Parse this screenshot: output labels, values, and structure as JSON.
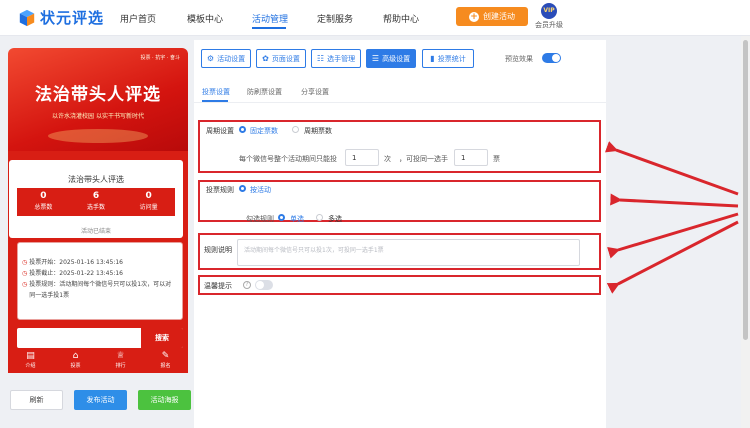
{
  "brand": {
    "name": "状元评选"
  },
  "nav": {
    "items": [
      "用户首页",
      "模板中心",
      "活动管理",
      "定制服务",
      "帮助中心"
    ],
    "active_index": 2,
    "create_label": "创建活动",
    "vip_badge": "VIP",
    "vip_label": "会员升级"
  },
  "preview": {
    "banner_tag": "投票 · 抗宇 · 奋斗",
    "banner_title": "法治带头人评选",
    "banner_sub": "以许水浇灌校园 以实干书写新时代",
    "card_title": "法治带头人评选",
    "stats": [
      {
        "num": "0",
        "label": "总票数"
      },
      {
        "num": "6",
        "label": "选手数"
      },
      {
        "num": "0",
        "label": "访问量"
      }
    ],
    "status": "活动已结束",
    "info": [
      "投票开始：2025-01-16 13:45:16",
      "投票截止：2025-01-22 13:45:16",
      "投票规则：活动期间每个微信号只可以投1次，可以对同一选手投1票"
    ],
    "search_btn": "搜索",
    "tabs": [
      {
        "icon": "list-icon",
        "label": "介绍"
      },
      {
        "icon": "home-icon",
        "label": "投票"
      },
      {
        "icon": "trophy-icon",
        "label": "排行"
      },
      {
        "icon": "signup-icon",
        "label": "报名"
      }
    ]
  },
  "actions": {
    "refresh": "刷新",
    "publish": "发布活动",
    "poster": "活动海报"
  },
  "settings": {
    "toolbar": [
      {
        "icon": "gear-icon",
        "label": "活动设置",
        "active": false
      },
      {
        "icon": "palette-icon",
        "label": "页面设置",
        "active": false
      },
      {
        "icon": "users-icon",
        "label": "选手管理",
        "active": false
      },
      {
        "icon": "sliders-icon",
        "label": "高级设置",
        "active": true
      },
      {
        "icon": "bar-chart-icon",
        "label": "投票统计",
        "active": false
      }
    ],
    "preview_label": "预览效果",
    "subtabs": [
      "投票设置",
      "防刷票设置",
      "分享设置"
    ],
    "cycle": {
      "label": "周期设置",
      "opt1": "固定票数",
      "opt2": "周期票数",
      "sentence_a": "每个微信号整个活动期间只能投",
      "value_a": "1",
      "unit_a": "次",
      "sentence_b": "，可投同一选手",
      "value_b": "1",
      "unit_b": "票"
    },
    "rule": {
      "label": "投票规则",
      "option": "按活动",
      "check_label": "勾选规则",
      "single": "单选",
      "multi": "多选"
    },
    "desc": {
      "label": "规则说明",
      "placeholder": "活动期间每个微信号只可以投1次，可投同一选手1票"
    },
    "tip": {
      "label": "温馨提示",
      "help": "?"
    }
  },
  "colors": {
    "accent": "#2e7be6",
    "brand_red": "#d81e14",
    "highlight": "#d9262c",
    "orange": "#f68b1f",
    "green": "#4cc23f"
  }
}
